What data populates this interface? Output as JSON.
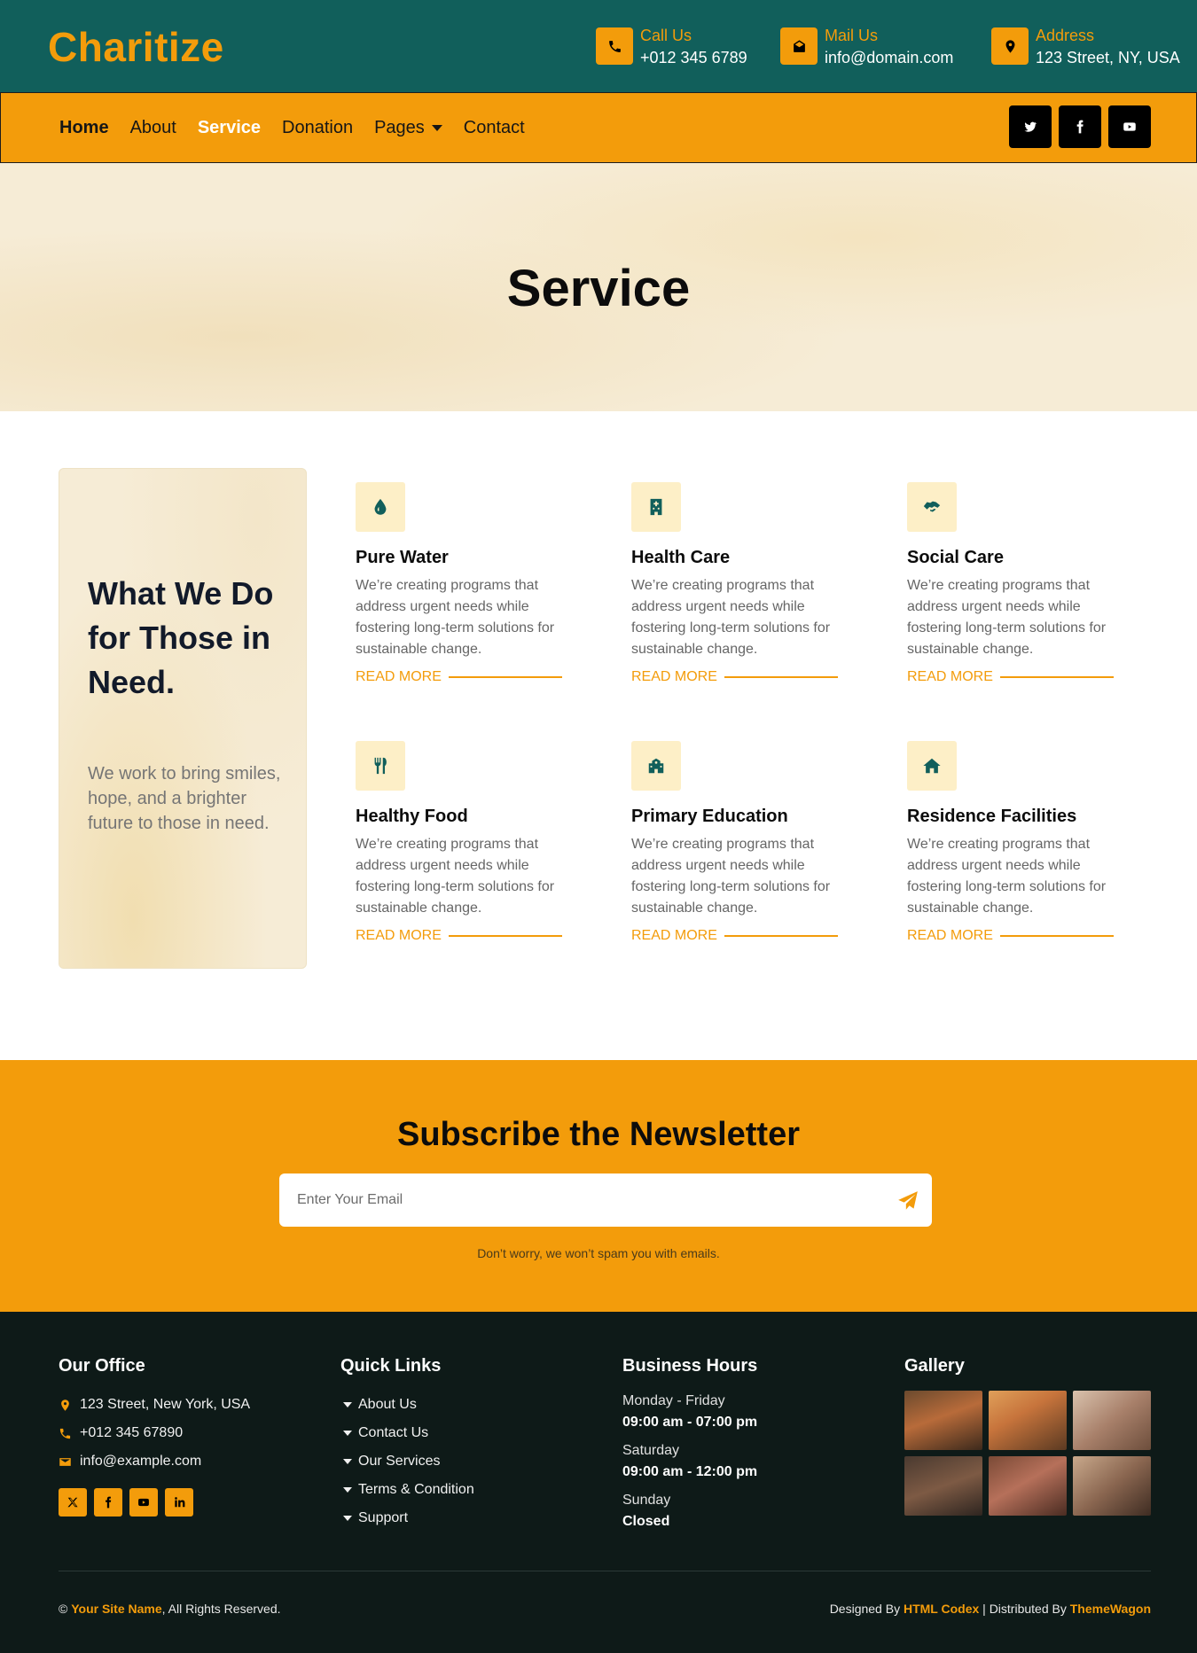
{
  "header": {
    "brand": "Charitize",
    "call": {
      "label": "Call Us",
      "value": "+012 345 6789"
    },
    "mail": {
      "label": "Mail Us",
      "value": "info@domain.com"
    },
    "address": {
      "label": "Address",
      "value": "123 Street, NY, USA"
    }
  },
  "nav": {
    "items": [
      "Home",
      "About",
      "Service",
      "Donation",
      "Pages",
      "Contact"
    ],
    "active": "Service"
  },
  "hero": {
    "title": "Service"
  },
  "services": {
    "intro_title": "What We Do for Those in Need.",
    "intro_text": "We work to bring smiles, hope, and a brighter future to those in need.",
    "read_more": "READ MORE",
    "items": [
      {
        "title": "Pure Water",
        "icon": "water-drop-icon",
        "desc": "We’re creating programs that address urgent needs while fostering long-term solutions for sustainable change."
      },
      {
        "title": "Health Care",
        "icon": "hospital-icon",
        "desc": "We’re creating programs that address urgent needs while fostering long-term solutions for sustainable change."
      },
      {
        "title": "Social Care",
        "icon": "handshake-icon",
        "desc": "We’re creating programs that address urgent needs while fostering long-term solutions for sustainable change."
      },
      {
        "title": "Healthy Food",
        "icon": "utensils-icon",
        "desc": "We’re creating programs that address urgent needs while fostering long-term solutions for sustainable change."
      },
      {
        "title": "Primary Education",
        "icon": "school-icon",
        "desc": "We’re creating programs that address urgent needs while fostering long-term solutions for sustainable change."
      },
      {
        "title": "Residence Facilities",
        "icon": "home-icon",
        "desc": "We’re creating programs that address urgent needs while fostering long-term solutions for sustainable change."
      }
    ]
  },
  "newsletter": {
    "title": "Subscribe the Newsletter",
    "placeholder": "Enter Your Email",
    "note": "Don’t worry, we won’t spam you with emails."
  },
  "footer": {
    "office": {
      "heading": "Our Office",
      "address": "123 Street, New York, USA",
      "phone": "+012 345 67890",
      "email": "info@example.com"
    },
    "links": {
      "heading": "Quick Links",
      "items": [
        "About Us",
        "Contact Us",
        "Our Services",
        "Terms & Condition",
        "Support"
      ]
    },
    "hours": {
      "heading": "Business Hours",
      "rows": [
        {
          "day": "Monday - Friday",
          "time": "09:00 am - 07:00 pm"
        },
        {
          "day": "Saturday",
          "time": "09:00 am - 12:00 pm"
        },
        {
          "day": "Sunday",
          "time": "Closed"
        }
      ]
    },
    "gallery": {
      "heading": "Gallery"
    },
    "copyright": {
      "prefix": "©",
      "site": "Your Site Name",
      "suffix": ", All Rights Reserved."
    },
    "credit": {
      "designed_prefix": "Designed By",
      "designer": "HTML Codex",
      "separator": "| Distributed By",
      "distributor": "ThemeWagon"
    }
  },
  "colors": {
    "primary": "#115f5b",
    "accent": "#f39c0b",
    "dark": "#0e1a18"
  }
}
